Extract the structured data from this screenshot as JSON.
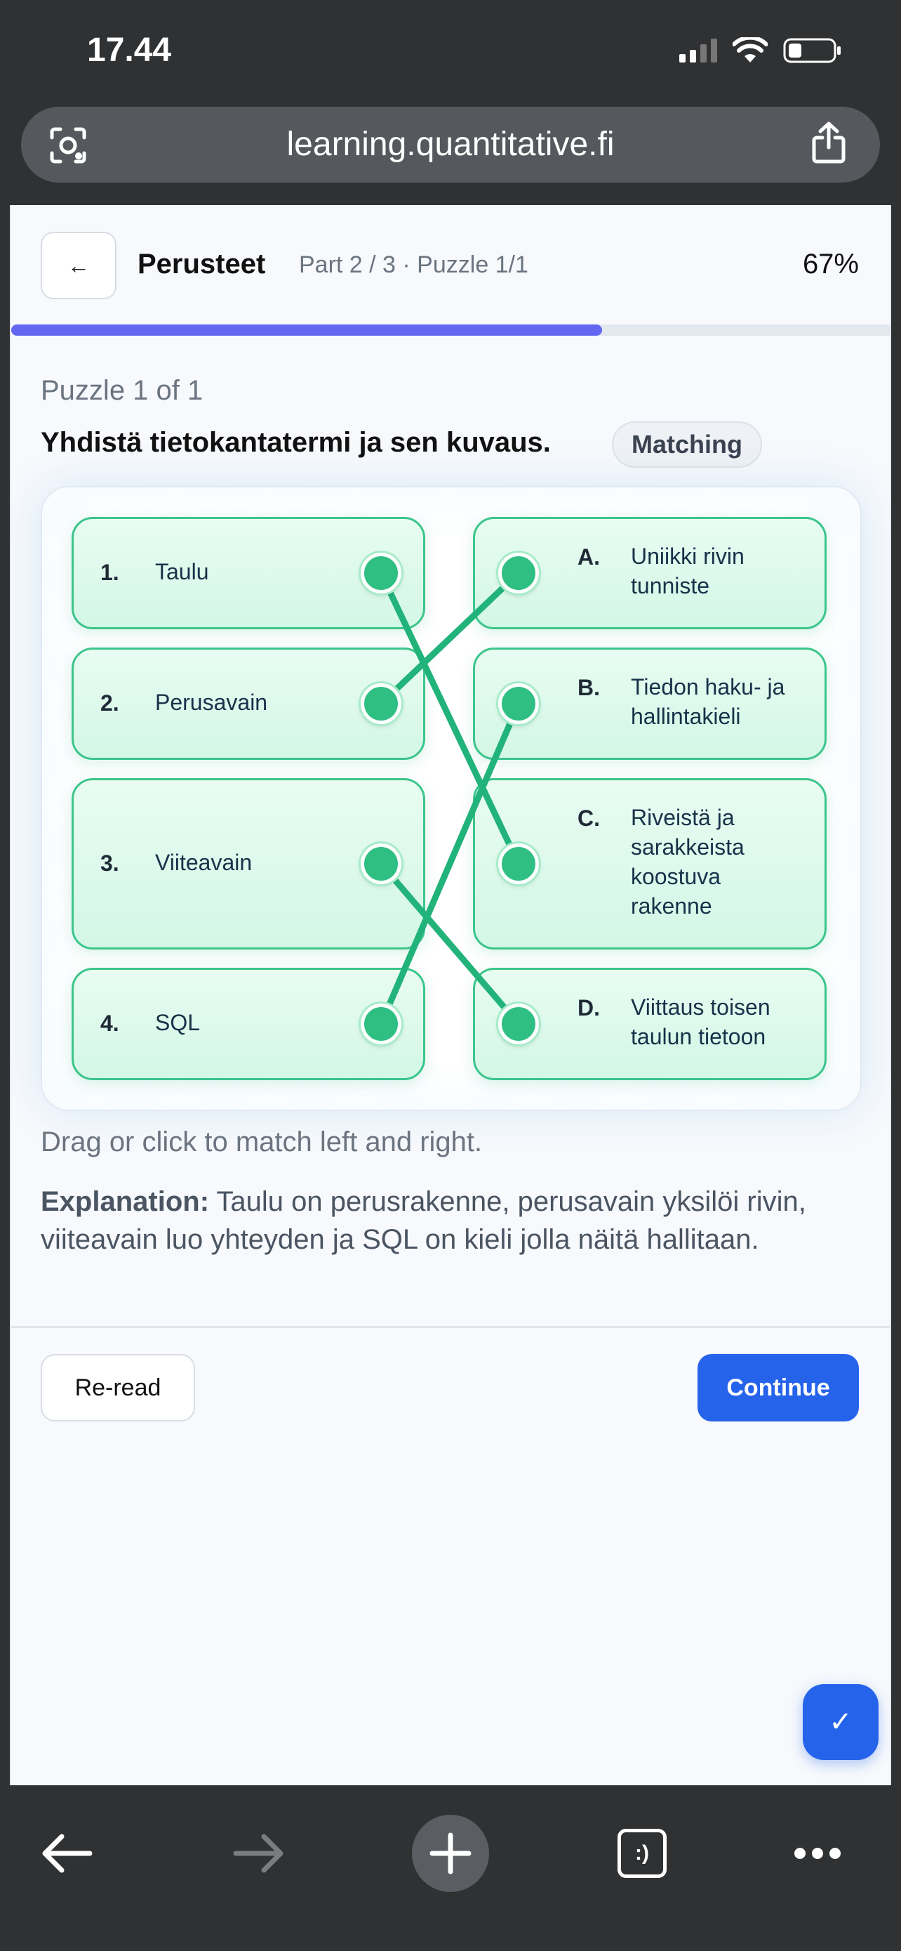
{
  "status_bar": {
    "time": "17.44"
  },
  "browser": {
    "url": "learning.quantitative.fi"
  },
  "header": {
    "back_label": "←",
    "title": "Perusteet",
    "subtitle": "Part 2 / 3 · Puzzle 1/1",
    "progress_text": "67%",
    "progress_fraction": 0.67
  },
  "puzzle": {
    "count_label": "Puzzle 1 of 1",
    "question": "Yhdistä tietokantatermi ja sen kuvaus.",
    "type_badge": "Matching",
    "left_items": [
      {
        "num": "1.",
        "text": "Taulu"
      },
      {
        "num": "2.",
        "text": "Perusavain"
      },
      {
        "num": "3.",
        "text": "Viiteavain"
      },
      {
        "num": "4.",
        "text": "SQL"
      }
    ],
    "right_items": [
      {
        "letter": "A.",
        "text": "Uniikki rivin tunniste"
      },
      {
        "letter": "B.",
        "text": "Tiedon haku- ja hallintakieli"
      },
      {
        "letter": "C.",
        "text": "Riveistä ja sarakkeista koostuva rakenne"
      },
      {
        "letter": "D.",
        "text": "Viittaus toisen taulun tietoon"
      }
    ],
    "matches": [
      [
        0,
        2
      ],
      [
        1,
        0
      ],
      [
        2,
        3
      ],
      [
        3,
        1
      ]
    ],
    "line_color": "#22b37a",
    "hint": "Drag or click to match left and right.",
    "explanation_label": "Explanation:",
    "explanation_text": " Taulu on perusrakenne, perusavain yksilöi rivin, viiteavain luo yhteyden ja SQL on kieli jolla näitä hallitaan."
  },
  "actions": {
    "reread_label": "Re-read",
    "continue_label": "Continue",
    "fab_label": "✓"
  },
  "icons": {
    "back": "arrow-left-icon",
    "lens": "camera-lens-icon",
    "share": "share-icon",
    "tabs_label": ":)"
  },
  "colors": {
    "accent": "#2563eb",
    "progress": "#6366f1",
    "match_green": "#2fbf83"
  }
}
